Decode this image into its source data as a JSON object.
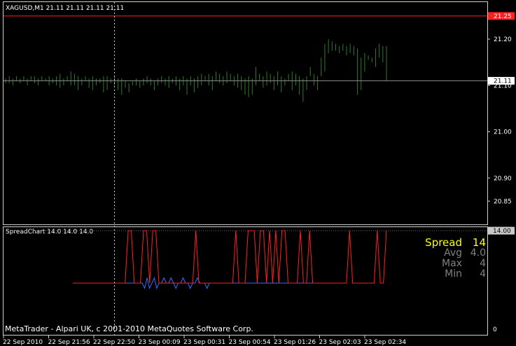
{
  "main_chart": {
    "header": "XAGUSD,M1  21.11 21.11 21.11 21.11",
    "ylim": [
      20.8,
      21.28
    ],
    "y_ticks": [
      "21.20",
      "21.10",
      "21.00",
      "20.90",
      "20.85"
    ],
    "y_tick_values": [
      21.2,
      21.1,
      21.0,
      20.9,
      20.85
    ],
    "red_line": {
      "label": "21.25",
      "value": 21.25
    },
    "bid_line": {
      "label": "21.11",
      "value": 21.11
    },
    "colors": {
      "bars": "#2f7a2f",
      "red_line": "#ff2020",
      "bid_line": "#8c8c8c"
    },
    "bars": [
      [
        21.115,
        21.105
      ],
      [
        21.12,
        21.105
      ],
      [
        21.115,
        21.1
      ],
      [
        21.12,
        21.11
      ],
      [
        21.115,
        21.105
      ],
      [
        21.12,
        21.11
      ],
      [
        21.115,
        21.1
      ],
      [
        21.12,
        21.11
      ],
      [
        21.12,
        21.105
      ],
      [
        21.115,
        21.1
      ],
      [
        21.12,
        21.11
      ],
      [
        21.115,
        21.11
      ],
      [
        21.12,
        21.1
      ],
      [
        21.115,
        21.105
      ],
      [
        21.12,
        21.1
      ],
      [
        21.125,
        21.095
      ],
      [
        21.115,
        21.1
      ],
      [
        21.12,
        21.11
      ],
      [
        21.13,
        21.1
      ],
      [
        21.125,
        21.1
      ],
      [
        21.12,
        21.09
      ],
      [
        21.115,
        21.1
      ],
      [
        21.12,
        21.11
      ],
      [
        21.115,
        21.095
      ],
      [
        21.12,
        21.09
      ],
      [
        21.115,
        21.1
      ],
      [
        21.115,
        21.105
      ],
      [
        21.12,
        21.085
      ],
      [
        21.12,
        21.09
      ],
      [
        21.115,
        21.105
      ],
      [
        21.12,
        21.1
      ],
      [
        21.115,
        21.09
      ],
      [
        21.115,
        21.08
      ],
      [
        21.11,
        21.095
      ],
      [
        21.105,
        21.085
      ],
      [
        21.11,
        21.1
      ],
      [
        21.115,
        21.1
      ],
      [
        21.11,
        21.095
      ],
      [
        21.115,
        21.1
      ],
      [
        21.12,
        21.105
      ],
      [
        21.115,
        21.1
      ],
      [
        21.11,
        21.09
      ],
      [
        21.115,
        21.1
      ],
      [
        21.12,
        21.105
      ],
      [
        21.115,
        21.1
      ],
      [
        21.12,
        21.095
      ],
      [
        21.115,
        21.105
      ],
      [
        21.12,
        21.1
      ],
      [
        21.115,
        21.09
      ],
      [
        21.12,
        21.1
      ],
      [
        21.115,
        21.08
      ],
      [
        21.12,
        21.1
      ],
      [
        21.115,
        21.085
      ],
      [
        21.12,
        21.095
      ],
      [
        21.125,
        21.1
      ],
      [
        21.12,
        21.11
      ],
      [
        21.125,
        21.1
      ],
      [
        21.12,
        21.09
      ],
      [
        21.13,
        21.11
      ],
      [
        21.125,
        21.105
      ],
      [
        21.12,
        21.1
      ],
      [
        21.13,
        21.105
      ],
      [
        21.125,
        21.11
      ],
      [
        21.12,
        21.1
      ],
      [
        21.125,
        21.095
      ],
      [
        21.12,
        21.09
      ],
      [
        21.115,
        21.08
      ],
      [
        21.12,
        21.075
      ],
      [
        21.115,
        21.08
      ],
      [
        21.14,
        21.1
      ],
      [
        21.125,
        21.11
      ],
      [
        21.12,
        21.095
      ],
      [
        21.13,
        21.1
      ],
      [
        21.125,
        21.105
      ],
      [
        21.12,
        21.09
      ],
      [
        21.13,
        21.1
      ],
      [
        21.12,
        21.085
      ],
      [
        21.115,
        21.1
      ],
      [
        21.125,
        21.11
      ],
      [
        21.13,
        21.09
      ],
      [
        21.125,
        21.1
      ],
      [
        21.12,
        21.08
      ],
      [
        21.115,
        21.065
      ],
      [
        21.12,
        21.09
      ],
      [
        21.14,
        21.12
      ],
      [
        21.125,
        21.1
      ],
      [
        21.12,
        21.09
      ],
      [
        21.16,
        21.12
      ],
      [
        21.19,
        21.13
      ],
      [
        21.2,
        21.17
      ],
      [
        21.195,
        21.175
      ],
      [
        21.19,
        21.175
      ],
      [
        21.185,
        21.17
      ],
      [
        21.19,
        21.175
      ],
      [
        21.185,
        21.165
      ],
      [
        21.19,
        21.17
      ],
      [
        21.185,
        21.165
      ],
      [
        21.18,
        21.08
      ],
      [
        21.16,
        21.09
      ],
      [
        21.17,
        21.13
      ],
      [
        21.165,
        21.155
      ],
      [
        21.16,
        21.15
      ],
      [
        21.18,
        21.14
      ],
      [
        21.19,
        21.16
      ],
      [
        21.185,
        21.15
      ],
      [
        21.185,
        21.11
      ]
    ]
  },
  "indicator": {
    "header": "SpreadChart 14.0 14.0 14.0",
    "level_label": "14.00",
    "level_value": 14,
    "bottom_tick": "0",
    "ylim": [
      0,
      14
    ],
    "stats": [
      {
        "label": "Spread",
        "value": "14",
        "color": "#ffff00"
      },
      {
        "label": "Avg",
        "value": "4.0",
        "color": "#808080"
      },
      {
        "label": "Max",
        "value": "4",
        "color": "#808080"
      },
      {
        "label": "Min",
        "value": "4",
        "color": "#808080"
      }
    ],
    "copyright": "MetaTrader - Alpari UK, c 2001-2010 MetaQuotes Software Corp.",
    "colors": {
      "spread": "#ff2020",
      "avg": "#2f6fff"
    },
    "spread_series": [
      4,
      4,
      4,
      4,
      4,
      4,
      4,
      4,
      4,
      4,
      4,
      4,
      4,
      4,
      4,
      4,
      4,
      4,
      14,
      14,
      4,
      4,
      4,
      14,
      14,
      4,
      14,
      14,
      4,
      4,
      4,
      4,
      4,
      4,
      4,
      4,
      4,
      4,
      4,
      4,
      14,
      4,
      4,
      4,
      4,
      4,
      4,
      4,
      4,
      4,
      4,
      4,
      4,
      14,
      4,
      4,
      4,
      14,
      14,
      14,
      4,
      14,
      14,
      4,
      14,
      4,
      14,
      4,
      14,
      14,
      4,
      4,
      4,
      4,
      14,
      4,
      4,
      14,
      4,
      4,
      4,
      4,
      4,
      4,
      4,
      4,
      4,
      4,
      4,
      4,
      14,
      4,
      4,
      4,
      4,
      4,
      4,
      4,
      4,
      14,
      4,
      4,
      14
    ],
    "avg_series": [
      4,
      4,
      4,
      4,
      4,
      4,
      4,
      4,
      4,
      4,
      4,
      4,
      4,
      4,
      4,
      4,
      4,
      4,
      4,
      4,
      4,
      4,
      4,
      4,
      4,
      4,
      4,
      4,
      4,
      4,
      3,
      5,
      3,
      4,
      5,
      3,
      4,
      4,
      5,
      4,
      4,
      5,
      4,
      3,
      4,
      4,
      5,
      4,
      4,
      3,
      4,
      4,
      5,
      4,
      4,
      4,
      3,
      4,
      4,
      4,
      4,
      4,
      4,
      4,
      4,
      4,
      4,
      4,
      4,
      4,
      4,
      4,
      4,
      4,
      4,
      4,
      4,
      4,
      4,
      4,
      4,
      4,
      4,
      4,
      4,
      4,
      4,
      4,
      4,
      4,
      4,
      4,
      4,
      4,
      4,
      4,
      4,
      4,
      4,
      4,
      4,
      4,
      4,
      4,
      4
    ]
  },
  "time_axis": [
    "22 Sep 2010",
    "22 Sep 21:56",
    "22 Sep 22:50",
    "23 Sep 00:09",
    "23 Sep 00:31",
    "23 Sep 00:54",
    "23 Sep 01:26",
    "23 Sep 02:03",
    "23 Sep 02:34"
  ]
}
